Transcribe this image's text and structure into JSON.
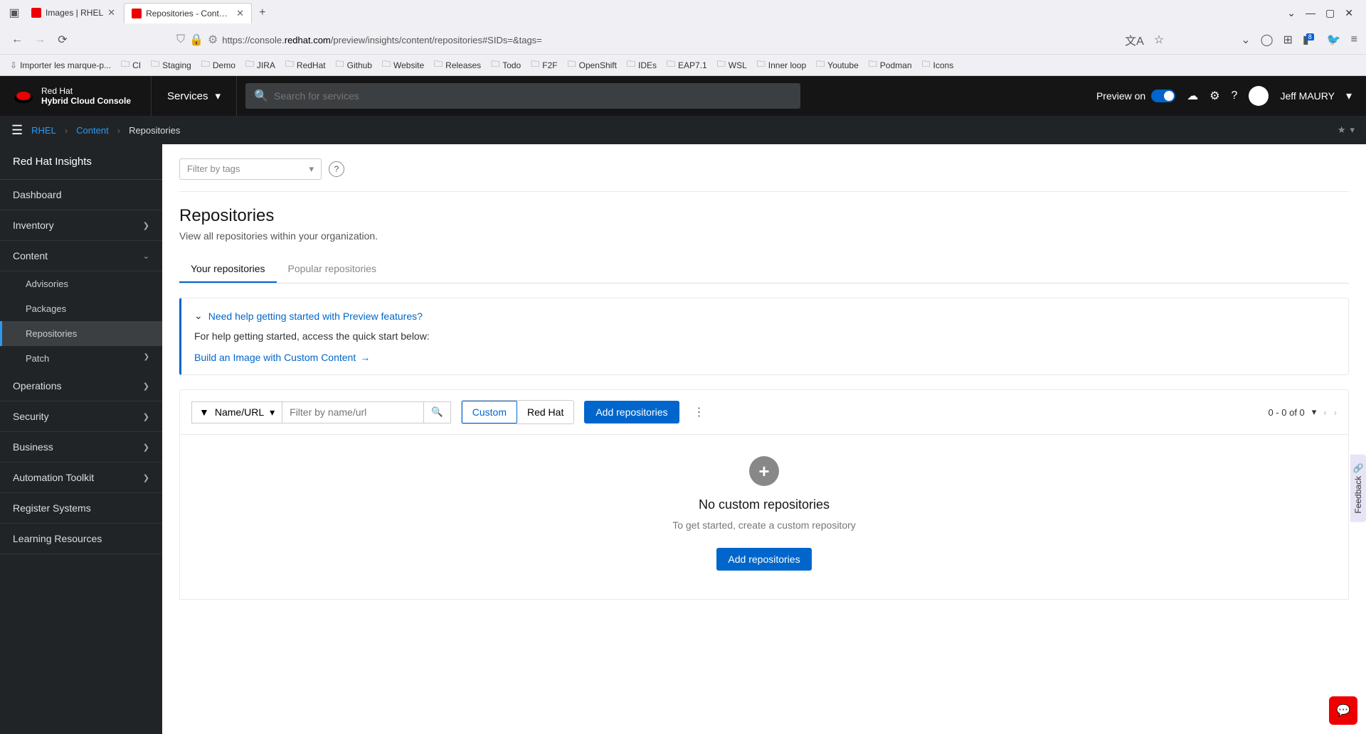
{
  "browser": {
    "tabs": [
      {
        "title": "Images | RHEL",
        "active": false
      },
      {
        "title": "Repositories - Content | RHEL",
        "active": true
      }
    ],
    "url_prefix": "https://console.",
    "url_domain": "redhat.com",
    "url_path": "/preview/insights/content/repositories#SIDs=&tags=",
    "notif_badge": "8",
    "bookmarks": [
      "Importer les marque-p...",
      "CI",
      "Staging",
      "Demo",
      "JIRA",
      "RedHat",
      "Github",
      "Website",
      "Releases",
      "Todo",
      "F2F",
      "OpenShift",
      "IDEs",
      "EAP7.1",
      "WSL",
      "Inner loop",
      "Youtube",
      "Podman",
      "Icons"
    ]
  },
  "header": {
    "brand_line1": "Red Hat",
    "brand_line2": "Hybrid Cloud Console",
    "services_label": "Services",
    "search_placeholder": "Search for services",
    "preview_label": "Preview on",
    "username": "Jeff MAURY"
  },
  "breadcrumb": {
    "items": [
      "RHEL",
      "Content",
      "Repositories"
    ]
  },
  "sidebar": {
    "title": "Red Hat Insights",
    "items": [
      {
        "label": "Dashboard",
        "expandable": false
      },
      {
        "label": "Inventory",
        "expandable": true
      },
      {
        "label": "Content",
        "expandable": true,
        "expanded": true,
        "children": [
          {
            "label": "Advisories"
          },
          {
            "label": "Packages"
          },
          {
            "label": "Repositories",
            "active": true
          },
          {
            "label": "Patch",
            "expandable": true
          }
        ]
      },
      {
        "label": "Operations",
        "expandable": true
      },
      {
        "label": "Security",
        "expandable": true
      },
      {
        "label": "Business",
        "expandable": true
      },
      {
        "label": "Automation Toolkit",
        "expandable": true
      },
      {
        "label": "Register Systems",
        "expandable": false
      },
      {
        "label": "Learning Resources",
        "expandable": false
      }
    ]
  },
  "main": {
    "tag_filter_placeholder": "Filter by tags",
    "page_title": "Repositories",
    "page_subtitle": "View all repositories within your organization.",
    "tabs": [
      {
        "label": "Your repositories",
        "active": true
      },
      {
        "label": "Popular repositories",
        "active": false
      }
    ],
    "info": {
      "title": "Need help getting started with Preview features?",
      "body": "For help getting started, access the quick start below:",
      "link": "Build an Image with Custom Content"
    },
    "toolbar": {
      "filter_label": "Name/URL",
      "filter_placeholder": "Filter by name/url",
      "group_custom": "Custom",
      "group_redhat": "Red Hat",
      "add_button": "Add repositories",
      "pager_text": "0 - 0 of 0"
    },
    "empty": {
      "title": "No custom repositories",
      "subtitle": "To get started, create a custom repository",
      "button": "Add repositories"
    }
  },
  "feedback_label": "Feedback"
}
